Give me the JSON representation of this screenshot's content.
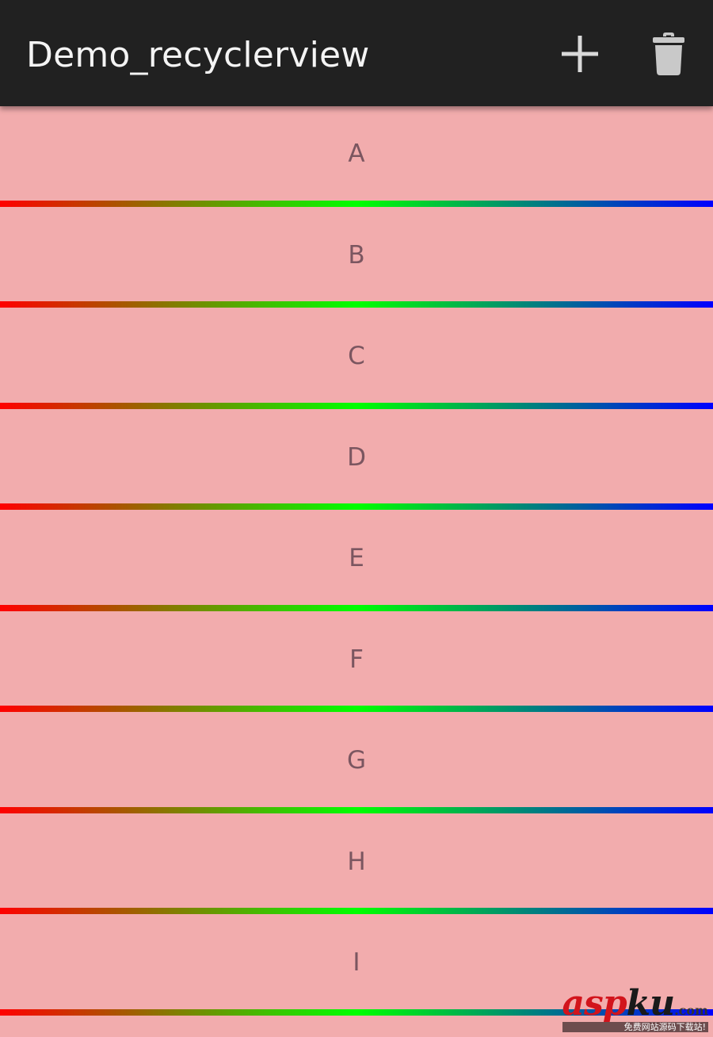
{
  "action_bar": {
    "title": "Demo_recyclerview",
    "background": "#212121",
    "actions": [
      {
        "name": "add",
        "icon": "plus-icon"
      },
      {
        "name": "delete",
        "icon": "trash-icon"
      }
    ]
  },
  "list": {
    "item_background": "#f2acad",
    "divider_gradient": [
      "#ff0000",
      "#00ff00",
      "#0000ff"
    ],
    "items": [
      {
        "label": "A"
      },
      {
        "label": "B"
      },
      {
        "label": "C"
      },
      {
        "label": "D"
      },
      {
        "label": "E"
      },
      {
        "label": "F"
      },
      {
        "label": "G"
      },
      {
        "label": "H"
      },
      {
        "label": "I"
      }
    ]
  },
  "watermark": {
    "logo_part1": "asp",
    "logo_part2": "ku",
    "domain": ".com",
    "subtitle": "免费网站源码下载站!"
  }
}
